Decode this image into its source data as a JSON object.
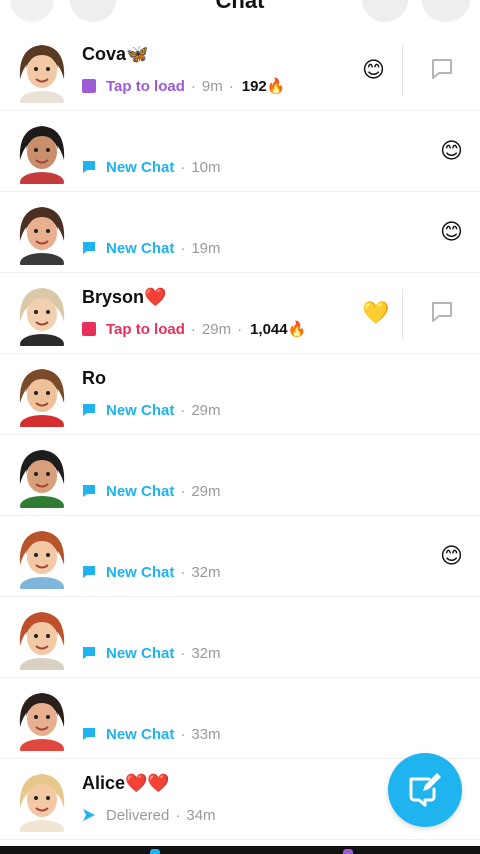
{
  "header": {
    "title": "Chat",
    "icons": [
      "profile-avatar",
      "search-icon",
      "add-friend-icon",
      "more-icon"
    ]
  },
  "colors": {
    "snap_purple": "#9b5cd6",
    "snap_red": "#e8315a",
    "chat_blue": "#1fb3f0",
    "meta_gray": "#9a9a9a"
  },
  "chats": [
    {
      "name": "Cova🦋",
      "status_kind": "snap_purple",
      "status": "Tap to load",
      "time": "9m",
      "streak": "192🔥",
      "emoji": "😊",
      "emoji_pos": "left",
      "reply_icon": true,
      "avatar_hair": "#5a3a22",
      "avatar_skin": "#f3c9a5",
      "avatar_top": "#e9e2d6"
    },
    {
      "name": "",
      "status_kind": "chat",
      "status": "New Chat",
      "time": "10m",
      "streak": "",
      "emoji": "😊",
      "emoji_pos": "right",
      "reply_icon": false,
      "avatar_hair": "#1f1a1a",
      "avatar_skin": "#c98f6a",
      "avatar_top": "#c43c3c"
    },
    {
      "name": "",
      "status_kind": "chat",
      "status": "New Chat",
      "time": "19m",
      "streak": "",
      "emoji": "😊",
      "emoji_pos": "right",
      "reply_icon": false,
      "avatar_hair": "#4a2f22",
      "avatar_skin": "#e8b08e",
      "avatar_top": "#3a3a3a"
    },
    {
      "name": "Bryson❤️",
      "status_kind": "snap_red",
      "status": "Tap to load",
      "time": "29m",
      "streak": "1,044🔥",
      "emoji": "💛",
      "emoji_pos": "left",
      "reply_icon": true,
      "avatar_hair": "#d9c9a8",
      "avatar_skin": "#f2cfae",
      "avatar_top": "#2b2b2b"
    },
    {
      "name": "Ro",
      "status_kind": "chat",
      "status": "New Chat",
      "time": "29m",
      "streak": "",
      "emoji": "",
      "emoji_pos": "right",
      "reply_icon": false,
      "avatar_hair": "#7a4a2a",
      "avatar_skin": "#efc19a",
      "avatar_top": "#d32f2f"
    },
    {
      "name": "",
      "status_kind": "chat",
      "status": "New Chat",
      "time": "29m",
      "streak": "",
      "emoji": "",
      "emoji_pos": "right",
      "reply_icon": false,
      "avatar_hair": "#1d1d1d",
      "avatar_skin": "#d8a07a",
      "avatar_top": "#2e7d32"
    },
    {
      "name": "",
      "status_kind": "chat",
      "status": "New Chat",
      "time": "32m",
      "streak": "",
      "emoji": "😊",
      "emoji_pos": "right",
      "reply_icon": false,
      "avatar_hair": "#b8532a",
      "avatar_skin": "#f3c9a5",
      "avatar_top": "#7fb6d9"
    },
    {
      "name": "",
      "status_kind": "chat",
      "status": "New Chat",
      "time": "32m",
      "streak": "",
      "emoji": "",
      "emoji_pos": "right",
      "reply_icon": false,
      "avatar_hair": "#c0502a",
      "avatar_skin": "#f3c9a5",
      "avatar_top": "#d9d0c4"
    },
    {
      "name": "",
      "status_kind": "chat",
      "status": "New Chat",
      "time": "33m",
      "streak": "",
      "emoji": "",
      "emoji_pos": "right",
      "reply_icon": false,
      "avatar_hair": "#2b1f1a",
      "avatar_skin": "#e8b08e",
      "avatar_top": "#e0483d"
    },
    {
      "name": "Alice❤️❤️",
      "status_kind": "delivered",
      "status": "Delivered",
      "time": "34m",
      "streak": "",
      "emoji": "",
      "emoji_pos": "right",
      "reply_icon": false,
      "avatar_hair": "#e6c98a",
      "avatar_skin": "#f3c9a5",
      "avatar_top": "#f0e6d2"
    }
  ],
  "fab": {
    "icon": "new-chat-icon"
  }
}
